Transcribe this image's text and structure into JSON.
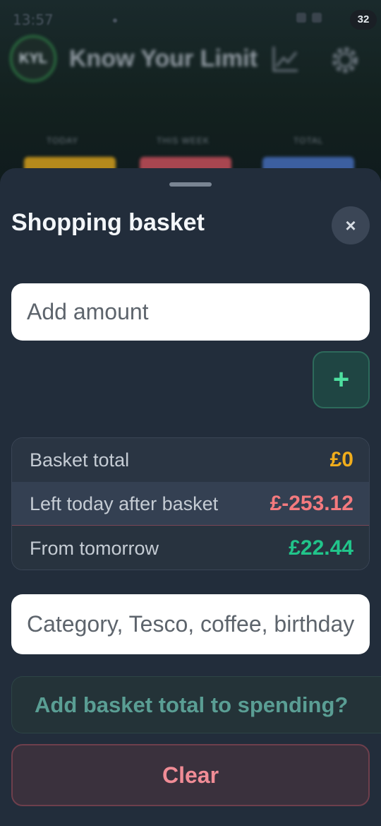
{
  "status_bar": {
    "time": "13:57",
    "battery": "32"
  },
  "app": {
    "logo": "KYL",
    "title": "Know Your Limit",
    "stats": [
      {
        "label": "TODAY",
        "color": "#b58a1c"
      },
      {
        "label": "THIS WEEK",
        "color": "#a84650"
      },
      {
        "label": "TOTAL",
        "color": "#3c5fa0"
      }
    ]
  },
  "sheet": {
    "title": "Shopping basket",
    "close_label": "×",
    "amount_placeholder": "Add amount",
    "add_label": "+",
    "summary": [
      {
        "label": "Basket total",
        "value": "£0",
        "color": "amber"
      },
      {
        "label": "Left today after basket",
        "value": "£-253.12",
        "color": "red"
      },
      {
        "label": "From tomorrow",
        "value": "£22.44",
        "color": "green"
      }
    ],
    "category_placeholder": "Category, Tesco, coffee, birthday...",
    "add_to_spending_label": "Add basket total to spending?",
    "clear_label": "Clear"
  },
  "icons": {
    "close": "close-icon",
    "add": "plus-icon",
    "chart": "chart-icon",
    "settings": "gear-icon"
  }
}
